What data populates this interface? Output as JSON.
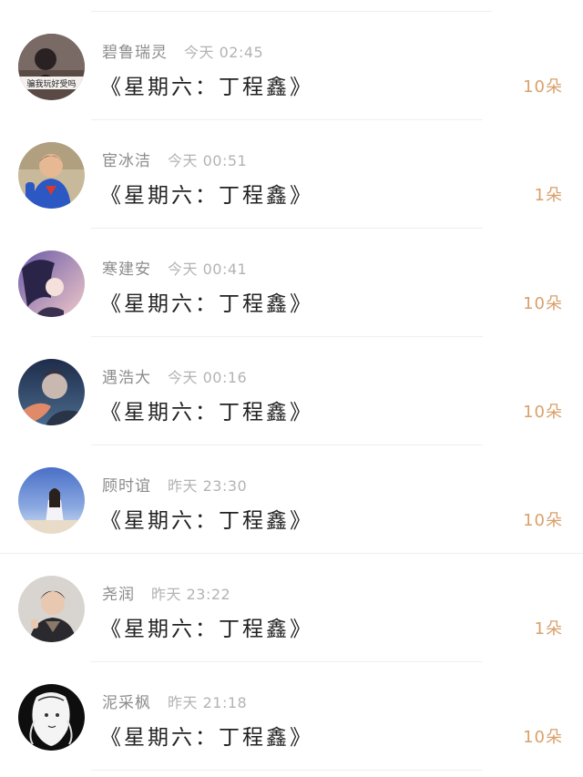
{
  "items": [
    {
      "name": "碧鲁瑞灵",
      "time": "今天 02:45",
      "title": "《星期六：丁程鑫》",
      "count": "10朵",
      "avatar_caption": "骗我玩好受吗"
    },
    {
      "name": "宦冰洁",
      "time": "今天 00:51",
      "title": "《星期六：丁程鑫》",
      "count": "1朵"
    },
    {
      "name": "寒建安",
      "time": "今天 00:41",
      "title": "《星期六：丁程鑫》",
      "count": "10朵"
    },
    {
      "name": "遇浩大",
      "time": "今天 00:16",
      "title": "《星期六：丁程鑫》",
      "count": "10朵"
    },
    {
      "name": "顾时谊",
      "time": "昨天 23:30",
      "title": "《星期六：丁程鑫》",
      "count": "10朵"
    },
    {
      "name": "尧润",
      "time": "昨天 23:22",
      "title": "《星期六：丁程鑫》",
      "count": "1朵"
    },
    {
      "name": "泥采枫",
      "time": "昨天 21:18",
      "title": "《星期六：丁程鑫》",
      "count": "10朵"
    }
  ],
  "colors": {
    "count": "#d9a06b",
    "name": "#8c8c8c",
    "time": "#b3b3b3",
    "title": "#222222"
  },
  "icons": [
    "avatar-photo-dark-figure",
    "avatar-photo-child-superhero",
    "avatar-photo-anime-purple",
    "avatar-photo-anime-night",
    "avatar-photo-girl-beach",
    "avatar-photo-boy-portrait",
    "avatar-photo-sketch-girl"
  ]
}
